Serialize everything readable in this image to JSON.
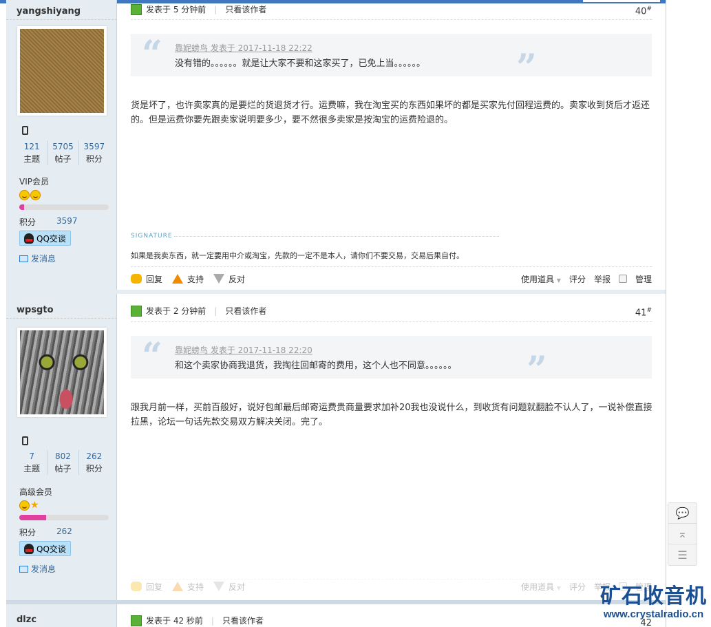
{
  "posts": [
    {
      "author": "yangshiyang",
      "posted": "发表于 5 分钟前",
      "only_author": "只看该作者",
      "floor": "40",
      "floor_mark": "#",
      "stats": [
        {
          "n": "121",
          "l": "主题"
        },
        {
          "n": "5705",
          "l": "帖子"
        },
        {
          "n": "3597",
          "l": "积分"
        }
      ],
      "level": "VIP会员",
      "level_progress": 0.05,
      "credits_label": "积分",
      "credits": "3597",
      "qq": "QQ交谈",
      "message": "发消息",
      "quote_meta": "靠妮螃鸟 发表于 2017-11-18 22:22",
      "quote_text": "没有错的。。。。。。就是让大家不要和这家买了，已免上当。。。。。。",
      "body": "货是坏了，也许卖家真的是要烂的货退货才行。运费嘛，我在淘宝买的东西如果坏的都是买家先付回程运费的。卖家收到货后才返还的。但是运费你要先跟卖家说明要多少，要不然很多卖家是按淘宝的运费险退的。",
      "signature_label": "SIGNATURE",
      "signature": "如果是我卖东西，就一定要用中介或淘宝，先款的一定不是本人，请你们不要交易，交易后果自付。"
    },
    {
      "author": "wpsgto",
      "posted": "发表于 2 分钟前",
      "only_author": "只看该作者",
      "floor": "41",
      "floor_mark": "#",
      "stats": [
        {
          "n": "7",
          "l": "主题"
        },
        {
          "n": "802",
          "l": "帖子"
        },
        {
          "n": "262",
          "l": "积分"
        }
      ],
      "level": "高级会员",
      "level_progress": 0.3,
      "credits_label": "积分",
      "credits": "262",
      "qq": "QQ交谈",
      "message": "发消息",
      "quote_meta": "靠妮螃鸟 发表于 2017-11-18 22:20",
      "quote_text": "和这个卖家协商我退货，我掏往回邮寄的费用，这个人也不同意。。。。。。",
      "body": "跟我月前一样，买前百般好，说好包邮最后邮寄运费贵商量要求加补20我也没说什么，到收货有问题就翻脸不认人了，一说补偿直接拉黑，论坛一句话先款交易双方解决关闭。完了。"
    },
    {
      "author": "dlzc",
      "posted": "发表于 42 秒前",
      "only_author": "只看该作者",
      "floor": "42"
    }
  ],
  "actions": {
    "reply": "回复",
    "support": "支持",
    "oppose": "反对",
    "use_tool": "使用道具",
    "rate": "评分",
    "report": "举报",
    "manage": "管理"
  },
  "float": {
    "reply_icon": "comment-icon",
    "top_icon": "back-to-top-icon",
    "list_icon": "list-icon"
  },
  "watermark": {
    "cn": "矿石收音机",
    "url": "www.crystalradio.cn"
  }
}
